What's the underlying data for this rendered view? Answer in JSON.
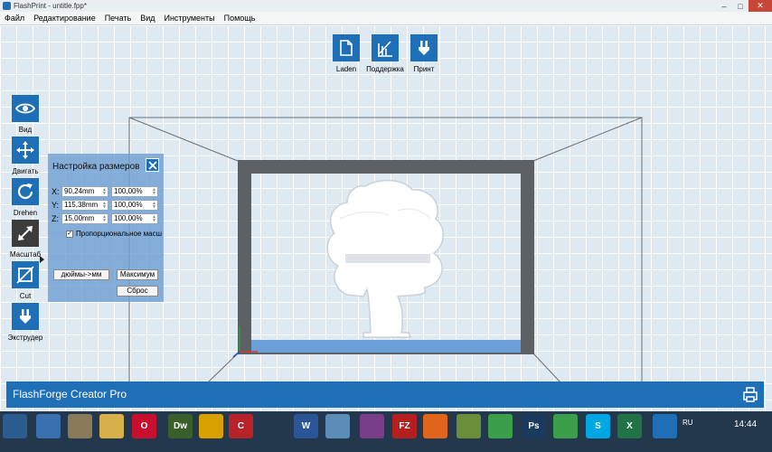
{
  "window": {
    "title": "FlashPrint - untitle.fpp*",
    "controls": [
      "–",
      "□",
      "✕"
    ]
  },
  "menu": [
    "Файл",
    "Редактирование",
    "Печать",
    "Вид",
    "Инструменты",
    "Помощь"
  ],
  "top_toolbar": [
    {
      "label": "Laden",
      "icon": "file-icon"
    },
    {
      "label": "Поддержка",
      "icon": "support-icon"
    },
    {
      "label": "Принт",
      "icon": "print-icon"
    }
  ],
  "left_toolbar": [
    {
      "label": "Вид",
      "icon": "eye-icon",
      "active": false
    },
    {
      "label": "Двигать",
      "icon": "move-icon",
      "active": false
    },
    {
      "label": "Drehen",
      "icon": "rotate-icon",
      "active": false
    },
    {
      "label": "Масштаб",
      "icon": "scale-icon",
      "active": true
    },
    {
      "label": "Cut",
      "icon": "cut-icon",
      "active": false
    },
    {
      "label": "Экструдер",
      "icon": "extruder-icon",
      "active": false
    }
  ],
  "scale_panel": {
    "title": "Настройка размеров",
    "x_label": "X:",
    "x_mm": "90,24mm",
    "x_pct": "100,00%",
    "y_label": "Y:",
    "y_mm": "115,38mm",
    "y_pct": "100,00%",
    "z_label": "Z:",
    "z_mm": "15,00mm",
    "z_pct": "100,00%",
    "proportional_label": "Пропорциональное масш",
    "proportional_checked": "✓",
    "inch_mm_button": "дюймы->мм",
    "max_button": "Максимум",
    "reset_button": "Сброс"
  },
  "status": {
    "printer": "FlashForge Creator Pro"
  },
  "taskbar": {
    "language": "RU",
    "time": "14:44",
    "apps": [
      {
        "icon": "windows-start-icon",
        "color": "#2b5c8f",
        "text": ""
      },
      {
        "icon": "lock-icon",
        "color": "#3a6fb0",
        "text": ""
      },
      {
        "icon": "paint-icon",
        "color": "#8a7a5a",
        "text": ""
      },
      {
        "icon": "explorer-icon",
        "color": "#d8b04a",
        "text": ""
      },
      {
        "icon": "opera-icon",
        "color": "#c8102e",
        "text": "O"
      },
      {
        "icon": "dreamweaver-icon",
        "color": "#3a5f2a",
        "text": "Dw"
      },
      {
        "icon": "warning-app-icon",
        "color": "#d9a100",
        "text": ""
      },
      {
        "icon": "ccleaner-icon",
        "color": "#b8232a",
        "text": "C"
      },
      {
        "icon": "word-icon",
        "color": "#2a5699",
        "text": "W"
      },
      {
        "icon": "notepad-icon",
        "color": "#5b8db8",
        "text": ""
      },
      {
        "icon": "winrar-icon",
        "color": "#7a3d8a",
        "text": ""
      },
      {
        "icon": "filezilla-icon",
        "color": "#b51f1f",
        "text": "FZ"
      },
      {
        "icon": "firefox-icon",
        "color": "#e0651b",
        "text": ""
      },
      {
        "icon": "chart-app-icon",
        "color": "#6b8e3a",
        "text": ""
      },
      {
        "icon": "chrome-icon",
        "color": "#3a9e4a",
        "text": ""
      },
      {
        "icon": "photoshop-icon",
        "color": "#1c3a5e",
        "text": "Ps"
      },
      {
        "icon": "chrome-icon-2",
        "color": "#3a9e4a",
        "text": ""
      },
      {
        "icon": "skype-icon",
        "color": "#00a7e3",
        "text": "S"
      },
      {
        "icon": "excel-icon",
        "color": "#217346",
        "text": "X"
      },
      {
        "icon": "flashprint-icon",
        "color": "#1f6fb6",
        "text": ""
      }
    ]
  },
  "colors": {
    "accent": "#1f6fb6",
    "panel": "#6fa0d2",
    "active_tool": "#3c3c3c"
  }
}
